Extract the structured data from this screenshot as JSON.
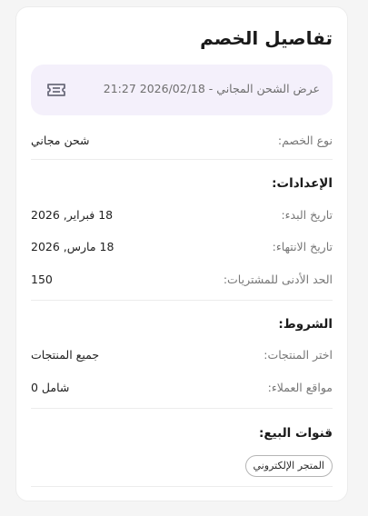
{
  "title": "تفاصيل الخصم",
  "offer": {
    "text": "عرض الشحن المجاني - 2026/02/18 21:27",
    "icon": "ticket-icon"
  },
  "discount_type": {
    "label": "نوع الخصم:",
    "value": "شحن مجاني"
  },
  "settings": {
    "title": "الإعدادات:",
    "start_date": {
      "label": "تاريخ البدء:",
      "value": "18 فبراير, 2026"
    },
    "end_date": {
      "label": "تاريخ الانتهاء:",
      "value": "18 مارس, 2026"
    },
    "min_purchase": {
      "label": "الحد الأدنى للمشتريات:",
      "value": "150"
    }
  },
  "conditions": {
    "title": "الشروط:",
    "products": {
      "label": "اختر المنتجات:",
      "value": "جميع المنتجات"
    },
    "customer_locations": {
      "label": "مواقع العملاء:",
      "value": "شامل 0"
    }
  },
  "sales_channels": {
    "title": "قنوات البيع:",
    "chips": [
      "المتجر الإلكتروني"
    ]
  },
  "colors": {
    "offer_background": "#f4f0fb",
    "icon_color": "#6b6b7b"
  }
}
